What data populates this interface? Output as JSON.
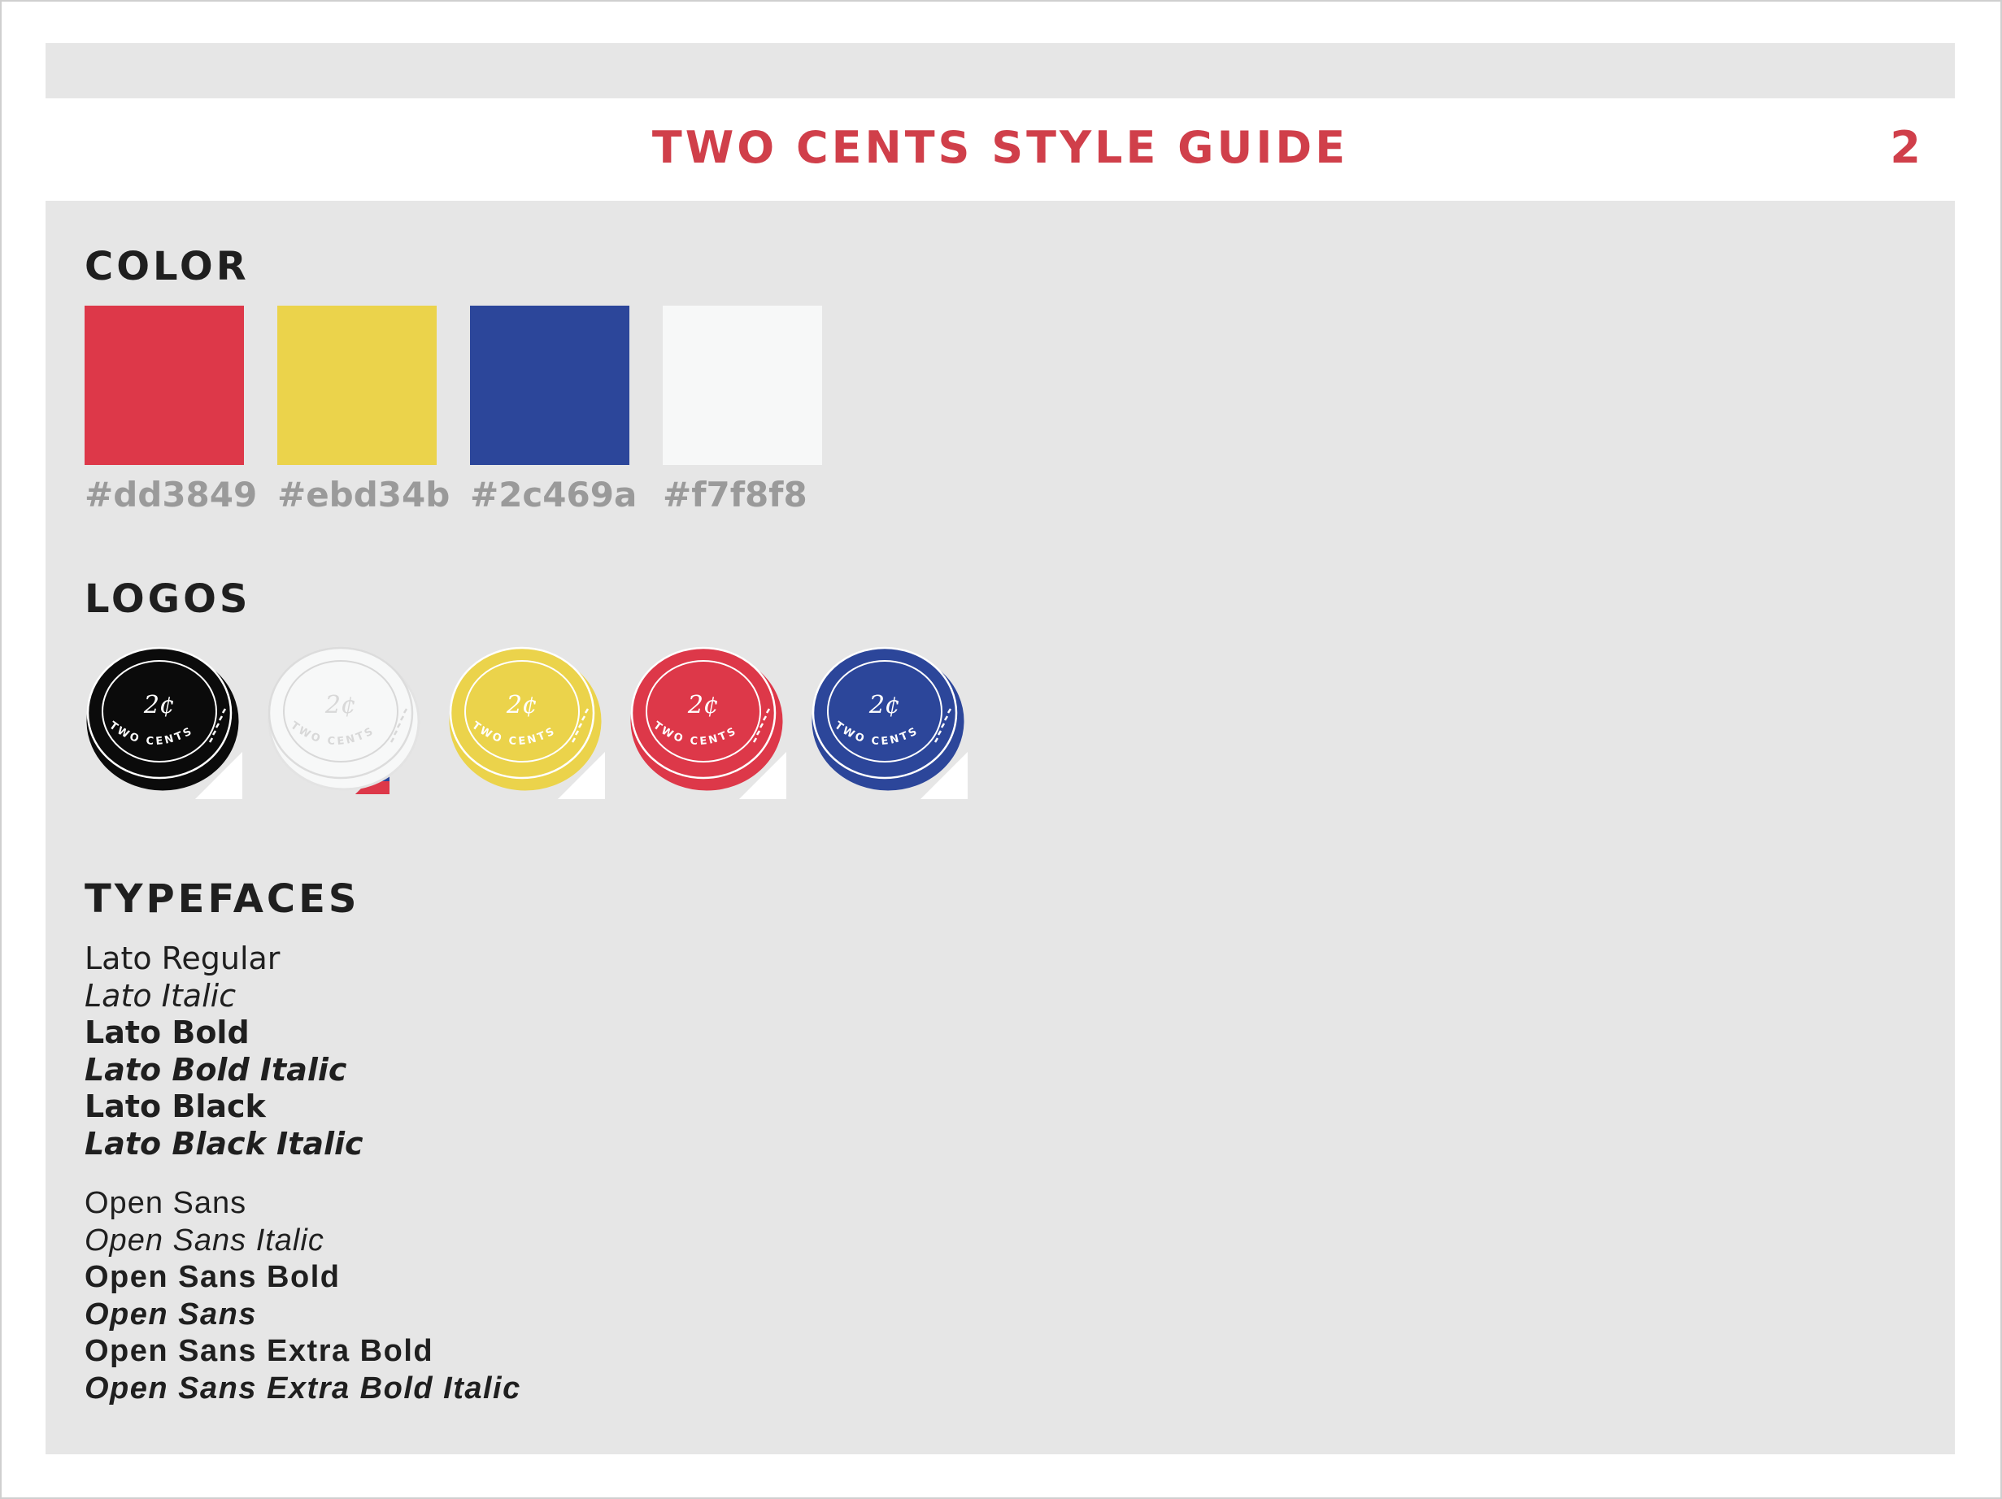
{
  "header": {
    "title": "TWO CENTS STYLE GUIDE",
    "page_number": "2"
  },
  "sections": {
    "color": "COLOR",
    "logos": "LOGOS",
    "typefaces": "TYPEFACES"
  },
  "colors": [
    {
      "hex": "#dd3849",
      "label": "#dd3849"
    },
    {
      "hex": "#ebd34b",
      "label": "#ebd34b"
    },
    {
      "hex": "#2c469a",
      "label": "#2c469a"
    },
    {
      "hex": "#f7f8f8",
      "label": "#f7f8f8"
    }
  ],
  "logos": [
    {
      "name": "logo-black",
      "coin_color": "#0b0b0b",
      "mark_color": "#ffffff"
    },
    {
      "name": "logo-white",
      "coin_color": "#f7f8f8",
      "mark_color": "#d8d8d8"
    },
    {
      "name": "logo-yellow",
      "coin_color": "#ebd34b",
      "mark_color": "#ffffff"
    },
    {
      "name": "logo-red",
      "coin_color": "#dd3849",
      "mark_color": "#ffffff"
    },
    {
      "name": "logo-blue",
      "coin_color": "#2c469a",
      "mark_color": "#ffffff"
    }
  ],
  "logo_text": {
    "mark": "2¢",
    "ring": "TWO CENTS"
  },
  "typefaces": {
    "lato": [
      "Lato Regular",
      "Lato Italic",
      "Lato Bold",
      "Lato Bold Italic",
      "Lato Black",
      "Lato Black Italic"
    ],
    "open_sans": [
      "Open Sans",
      "Open Sans Italic",
      "Open Sans Bold",
      "Open Sans",
      "Open Sans Extra Bold",
      "Open Sans Extra Bold Italic"
    ]
  }
}
